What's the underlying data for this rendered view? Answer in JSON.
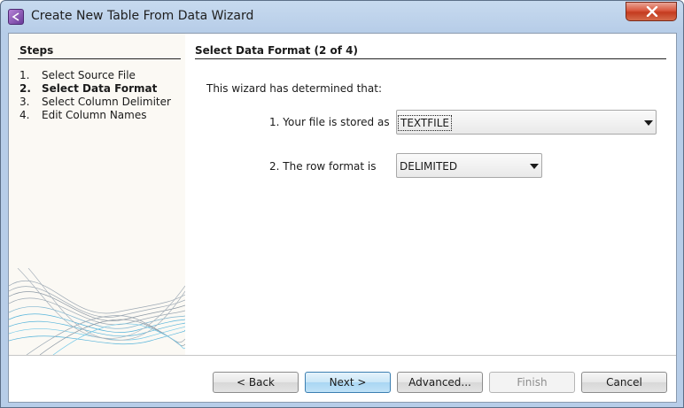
{
  "window": {
    "title": "Create New Table From Data Wizard"
  },
  "steps": {
    "header": "Steps",
    "items": [
      {
        "num": "1.",
        "label": "Select Source File"
      },
      {
        "num": "2.",
        "label": "Select Data Format"
      },
      {
        "num": "3.",
        "label": "Select Column Delimiter"
      },
      {
        "num": "4.",
        "label": "Edit Column Names"
      }
    ],
    "active_index": 1
  },
  "content": {
    "header": "Select Data Format (2 of 4)",
    "intro": "This wizard has determined that:",
    "file_stored": {
      "label": "1. Your file is stored as",
      "value": "TEXTFILE"
    },
    "row_format": {
      "label": "2. The row format is",
      "value": "DELIMITED"
    }
  },
  "buttons": {
    "back": "< Back",
    "next": "Next >",
    "advanced": "Advanced...",
    "finish": "Finish",
    "cancel": "Cancel"
  },
  "colors": {
    "title_bar": "#b7cde8",
    "close_button": "#c43b1f",
    "default_button": "#a9d6f3",
    "steps_panel": "#fbf9f4",
    "wave_blue": "#3aa8d6",
    "wave_gray": "#8c9aa8"
  },
  "icons": {
    "app": "wizard-app-icon",
    "close": "close-icon",
    "dropdown": "dropdown-arrow-icon"
  }
}
